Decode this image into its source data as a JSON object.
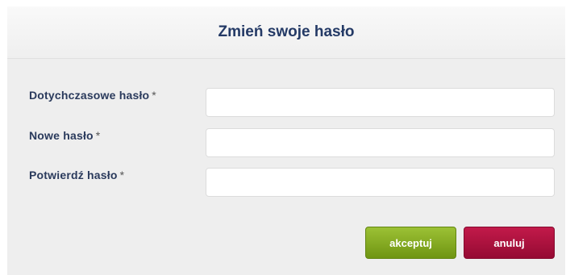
{
  "dialog": {
    "title": "Zmień swoje hasło"
  },
  "form": {
    "required_marker": "*",
    "fields": [
      {
        "label": "Dotychczasowe hasło",
        "value": "",
        "placeholder": ""
      },
      {
        "label": "Nowe hasło",
        "value": "",
        "placeholder": ""
      },
      {
        "label": "Potwierdź hasło",
        "value": "",
        "placeholder": ""
      }
    ]
  },
  "buttons": {
    "accept_label": "akceptuj",
    "cancel_label": "anuluj"
  },
  "colors": {
    "title": "#243a66",
    "accept": "#7fa51e",
    "cancel": "#ad1240"
  }
}
